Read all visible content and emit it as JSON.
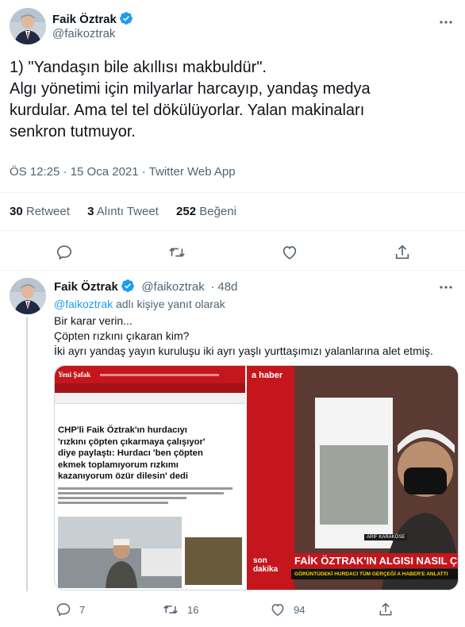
{
  "main_tweet": {
    "author_name": "Faik Öztrak",
    "author_handle": "@faikoztrak",
    "text_lines": [
      "1) \"Yandaşın bile akıllısı makbuldür\".",
      "Algı yönetimi için milyarlar harcayıp, yandaş medya",
      "kurdular. Ama tel tel dökülüyorlar. Yalan makinaları",
      "senkron tutmuyor."
    ],
    "meta": "ÖS 12:25 · 15 Oca 2021 · Twitter Web App",
    "stats": {
      "retweets_count": "30",
      "retweets_label": "Retweet",
      "quotes_count": "3",
      "quotes_label": "Alıntı Tweet",
      "likes_count": "252",
      "likes_label": "Beğeni"
    }
  },
  "reply_tweet": {
    "author_name": "Faik Öztrak",
    "author_handle": "@faikoztrak",
    "time": "· 48d",
    "reply_mention": "@faikoztrak",
    "reply_suffix": "adlı kişiye yanıt olarak",
    "body_lines": [
      "Bir karar verin...",
      "Çöpten rızkını çıkaran kim?",
      "İki ayrı yandaş yayın kuruluşu iki ayrı yaşlı yurttaşımızı yalanlarına alet etmiş."
    ],
    "counts": {
      "replies": "7",
      "retweets": "16",
      "likes": "94"
    },
    "media": {
      "left_site": "Yeni Şafak",
      "left_headline_lines": [
        "CHP'li Faik Öztrak'ın hurdacıyı",
        "'rızkını çöpten çıkarmaya çalışıyor'",
        "diye paylaştı: Hurdacı 'ben çöpten",
        "ekmek toplamıyorum rızkımı",
        "kazanıyorum özür dilesin' dedi"
      ],
      "right_channel": "a haber",
      "right_tag": "son dakika",
      "right_headline": "FAİK ÖZTRAK'IN ALGISI NASIL ÇÖKTÜ?",
      "right_sub": "GÖRÜNTÜDEKİ HURDACI TÜM GERÇEĞİ A HABER'E ANLATTI",
      "right_person": "ARİF KARAKÖSE"
    }
  },
  "colors": {
    "accent": "#1d9bf0",
    "text": "#0f1419",
    "muted": "#536471",
    "news_red": "#d71920"
  }
}
